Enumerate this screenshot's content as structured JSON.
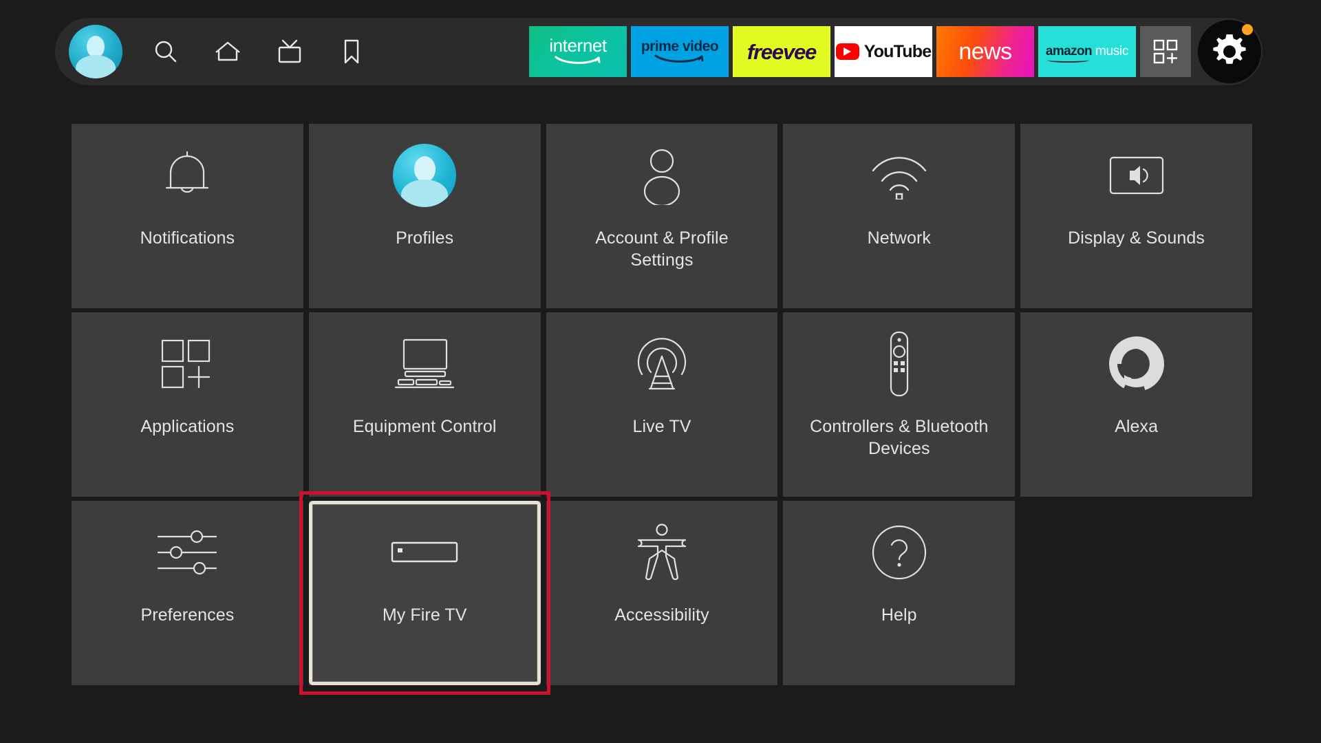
{
  "navbar": {
    "avatar": {
      "name": "user-avatar",
      "label": "Profile avatar"
    },
    "icons": [
      {
        "name": "search-icon",
        "label": "Search"
      },
      {
        "name": "home-icon",
        "label": "Home"
      },
      {
        "name": "live-tv-icon",
        "label": "Live TV"
      },
      {
        "name": "bookmark-icon",
        "label": "Watchlist"
      }
    ],
    "app_tiles": [
      {
        "name": "app-internet",
        "label": "internet",
        "bg": "#0cc3a0"
      },
      {
        "name": "app-prime-video",
        "label": "prime video",
        "bg": "#00a2e4"
      },
      {
        "name": "app-freevee",
        "label": "freevee",
        "bg": "#e2fb22"
      },
      {
        "name": "app-youtube",
        "label": "YouTube",
        "bg": "#ffffff"
      },
      {
        "name": "app-news",
        "label": "news",
        "bg": "#fb4c0e"
      },
      {
        "name": "app-amazon-music",
        "label_primary": "amazon",
        "label_secondary": "music",
        "bg": "#25e0d8"
      }
    ],
    "app_grid_button": {
      "name": "app-grid-button",
      "label": "Apps"
    },
    "settings_button": {
      "name": "settings-gear-button",
      "label": "Settings",
      "badge_color": "#ffa21c",
      "has_badge": true
    }
  },
  "settings_grid": {
    "tiles": [
      {
        "label": "Notifications",
        "icon": "bell-icon",
        "focused": false
      },
      {
        "label": "Profiles",
        "icon": "profile-avatar-icon",
        "focused": false
      },
      {
        "label": "Account & Profile Settings",
        "icon": "person-icon",
        "focused": false
      },
      {
        "label": "Network",
        "icon": "wifi-icon",
        "focused": false
      },
      {
        "label": "Display & Sounds",
        "icon": "display-sound-icon",
        "focused": false
      },
      {
        "label": "Applications",
        "icon": "applications-grid-icon",
        "focused": false
      },
      {
        "label": "Equipment Control",
        "icon": "equipment-control-icon",
        "focused": false
      },
      {
        "label": "Live TV",
        "icon": "broadcast-tower-icon",
        "focused": false
      },
      {
        "label": "Controllers & Bluetooth Devices",
        "icon": "remote-control-icon",
        "focused": false
      },
      {
        "label": "Alexa",
        "icon": "alexa-ring-icon",
        "focused": false
      },
      {
        "label": "Preferences",
        "icon": "sliders-icon",
        "focused": false
      },
      {
        "label": "My Fire TV",
        "icon": "fire-tv-stick-icon",
        "focused": true
      },
      {
        "label": "Accessibility",
        "icon": "accessibility-icon",
        "focused": false
      },
      {
        "label": "Help",
        "icon": "help-question-icon",
        "focused": false
      }
    ]
  },
  "theme": {
    "background": "#1b1b1b",
    "tile_background": "#3d3d3d",
    "topbar_background": "#2b2b2b",
    "text_color": "#e4e4e4",
    "focus_ring": "#e8e2d2",
    "annotation_box": "#cc1030"
  }
}
